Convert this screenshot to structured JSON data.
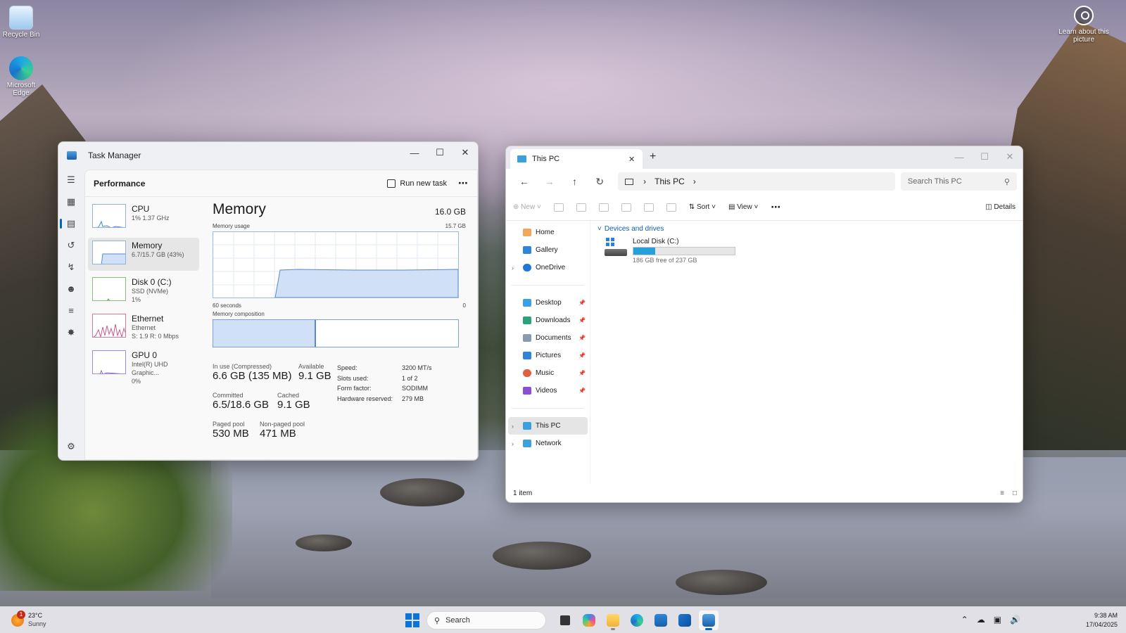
{
  "desktop": {
    "icons": [
      {
        "label": "Recycle Bin"
      },
      {
        "label": "Microsoft Edge"
      }
    ],
    "learn_label": "Learn about this picture"
  },
  "task_manager": {
    "title": "Task Manager",
    "section": "Performance",
    "run_new_task": "Run new task",
    "more": "⋯",
    "items": [
      {
        "name": "CPU",
        "sub1": "1% 1.37 GHz",
        "sub2": ""
      },
      {
        "name": "Memory",
        "sub1": "6.7/15.7 GB (43%)",
        "sub2": ""
      },
      {
        "name": "Disk 0 (C:)",
        "sub1": "SSD (NVMe)",
        "sub2": "1%"
      },
      {
        "name": "Ethernet",
        "sub1": "Ethernet",
        "sub2": "S: 1.9 R: 0 Mbps"
      },
      {
        "name": "GPU 0",
        "sub1": "Intel(R) UHD Graphic...",
        "sub2": "0%"
      }
    ],
    "memory": {
      "title": "Memory",
      "total": "16.0 GB",
      "usage_label": "Memory usage",
      "usage_max": "15.7 GB",
      "time_left": "60 seconds",
      "time_right": "0",
      "composition_label": "Memory composition",
      "composition_in_use_fraction": 0.42,
      "in_use_label": "In use (Compressed)",
      "in_use_value": "6.6 GB (135 MB)",
      "available_label": "Available",
      "available_value": "9.1 GB",
      "committed_label": "Committed",
      "committed_value": "6.5/18.6 GB",
      "cached_label": "Cached",
      "cached_value": "9.1 GB",
      "paged_label": "Paged pool",
      "paged_value": "530 MB",
      "nonpaged_label": "Non-paged pool",
      "nonpaged_value": "471 MB",
      "specs": [
        {
          "k": "Speed:",
          "v": "3200 MT/s"
        },
        {
          "k": "Slots used:",
          "v": "1 of 2"
        },
        {
          "k": "Form factor:",
          "v": "SODIMM"
        },
        {
          "k": "Hardware reserved:",
          "v": "279 MB"
        }
      ]
    }
  },
  "explorer": {
    "tab_title": "This PC",
    "address": "This PC",
    "search_placeholder": "Search This PC",
    "commands": {
      "new": "New",
      "sort": "Sort",
      "view": "View",
      "details": "Details",
      "more": "⋯"
    },
    "nav_top": [
      "Home",
      "Gallery",
      "OneDrive"
    ],
    "nav_pinned": [
      "Desktop",
      "Downloads",
      "Documents",
      "Pictures",
      "Music",
      "Videos"
    ],
    "nav_bottom": [
      "This PC",
      "Network"
    ],
    "group_label": "Devices and drives",
    "drive": {
      "name": "Local Disk (C:)",
      "free_text": "186 GB free of 237 GB",
      "used_fraction": 0.215
    },
    "status": "1 item"
  },
  "taskbar": {
    "weather_temp": "23°C",
    "weather_desc": "Sunny",
    "weather_badge": "1",
    "search_label": "Search",
    "time": "9:38 AM",
    "date": "17/04/2025"
  }
}
